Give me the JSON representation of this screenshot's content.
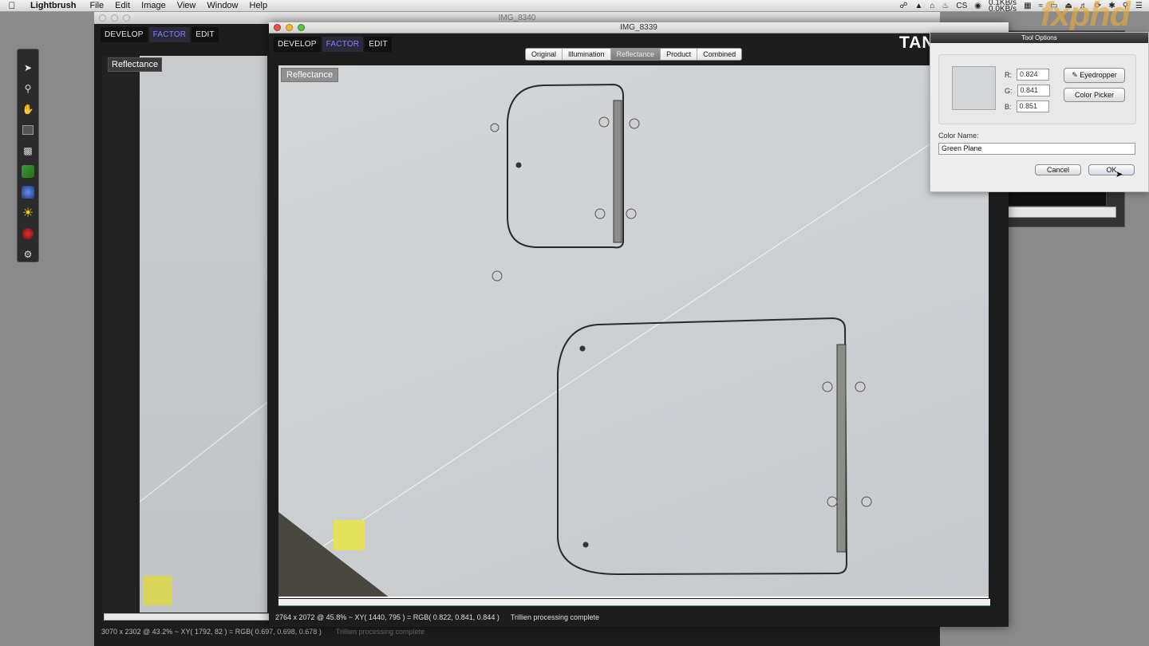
{
  "menubar": {
    "apple_icon": "apple-icon",
    "app_name": "Lightbrush",
    "items": [
      "File",
      "Edit",
      "Image",
      "View",
      "Window",
      "Help"
    ],
    "netspeed_up": "0.1KB/s",
    "netspeed_down": "0.0KB/s",
    "status_text": "CS"
  },
  "tool_palette": {
    "tools": [
      "arrow-select-icon",
      "zoom-icon",
      "hand-pan-icon",
      "rectangle-select-icon",
      "color-swatch-icon",
      "green-plane-icon",
      "blue-texture-icon",
      "illumination-sun-icon",
      "red-ball-icon",
      "gears-icon"
    ]
  },
  "back_window": {
    "title": "IMG_8340",
    "tabs": [
      "DEVELOP",
      "FACTOR",
      "EDIT"
    ],
    "active_tab": "FACTOR",
    "layer_label": "Reflectance",
    "status_info": "3070 x 2302 @ 43.2% ~ XY( 1792, 82 ) = RGB( 0.697, 0.698, 0.678 )",
    "status_message": "Trillien processing complete"
  },
  "front_window": {
    "title": "IMG_8339",
    "tabs": [
      "DEVELOP",
      "FACTOR",
      "EDIT"
    ],
    "active_tab": "FACTOR",
    "brand": "TANDENT",
    "layer_tabs": [
      "Original",
      "Illumination",
      "Reflectance",
      "Product",
      "Combined"
    ],
    "active_layer_tab": "Reflectance",
    "layer_label": "Reflectance",
    "status_info": "2764 x 2072 @ 45.8% ~ XY( 1440, 795 ) = RGB( 0.822, 0.841, 0.844 )",
    "status_message": "Trillien processing complete"
  },
  "tool_options": {
    "header": "Tool Options",
    "r_label": "R:",
    "g_label": "G:",
    "b_label": "B:",
    "r_value": "0.824",
    "g_value": "0.841",
    "b_value": "0.851",
    "eyedropper_label": "Eyedropper",
    "color_picker_label": "Color Picker",
    "color_name_label": "Color Name:",
    "color_name_value": "Green Plane",
    "cancel_label": "Cancel",
    "ok_label": "OK",
    "swatch_color": "#d2d6d9"
  },
  "layers_panel": {
    "add_label": "+",
    "remove_label": "−",
    "gear_label": "⚙▾"
  },
  "watermark": "fxphd"
}
